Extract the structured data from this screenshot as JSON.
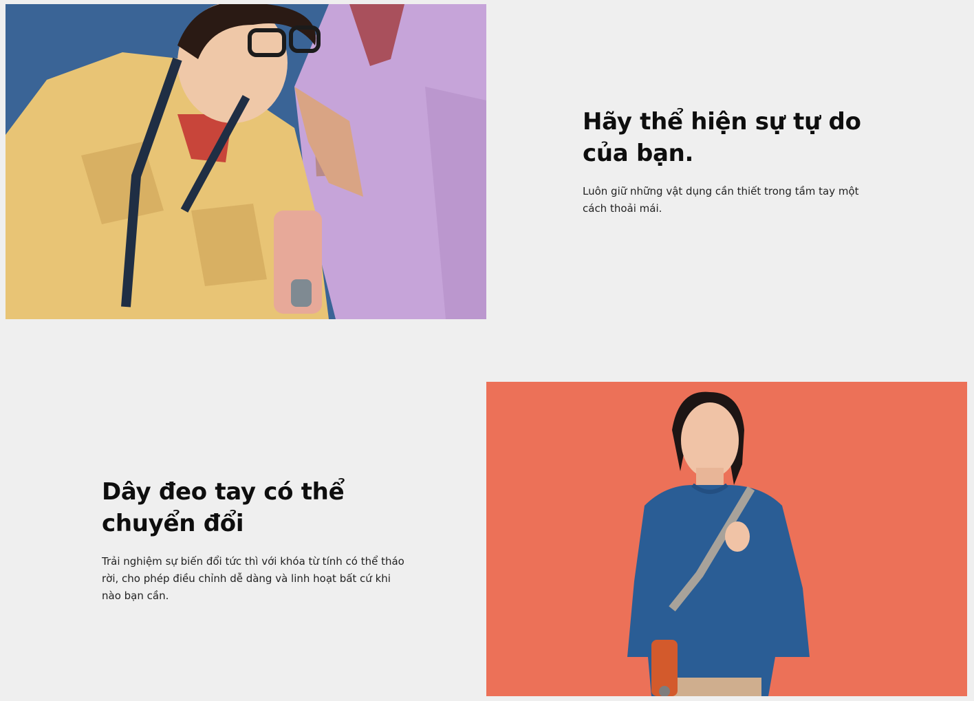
{
  "feature_1": {
    "heading": "Hãy thể hiện sự tự do của bạn.",
    "description": "Luôn giữ những vật dụng cần thiết trong tầm tay một cách thoải mái."
  },
  "feature_2": {
    "heading": "Dây đeo tay có thể chuyển đổi",
    "description": "Trải nghiệm sự biến đổi tức thì với khóa từ tính có thể tháo rời, cho phép điều chỉnh dễ dàng và linh hoạt bất cứ khi nào bạn cần."
  },
  "colors": {
    "page_background": "#efefef",
    "heading_text": "#0e0e0e",
    "body_text": "#222222",
    "photo_1_background": "#3a6496",
    "photo_2_background": "#ec7158"
  }
}
